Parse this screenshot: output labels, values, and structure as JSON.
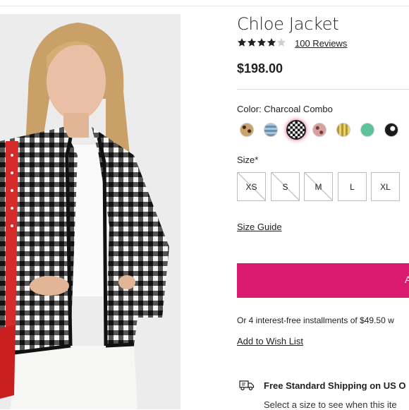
{
  "product": {
    "title": "Chloe Jacket",
    "rating": 4,
    "rating_max": 5,
    "reviews_label": "100 Reviews",
    "price": "$198.00"
  },
  "color": {
    "label": "Color: Charcoal Combo",
    "swatches": [
      {
        "name": "leopard",
        "color": "#c9a36b"
      },
      {
        "name": "blue-plaid",
        "color": "#8fb1cf"
      },
      {
        "name": "charcoal-gingham",
        "color": "#3a3a3a",
        "selected": true
      },
      {
        "name": "pink-leopard",
        "color": "#c88e8e"
      },
      {
        "name": "yellow-stripe",
        "color": "#c9b24a"
      },
      {
        "name": "green",
        "color": "#5cc49a"
      },
      {
        "name": "black-floral",
        "color": "#1a1a1a"
      }
    ]
  },
  "size": {
    "label": "Size*",
    "options": [
      {
        "label": "XS",
        "available": false
      },
      {
        "label": "S",
        "available": false
      },
      {
        "label": "M",
        "available": false
      },
      {
        "label": "L",
        "available": true
      },
      {
        "label": "XL",
        "available": true
      }
    ],
    "guide_label": "Size Guide"
  },
  "actions": {
    "add_to_bag_label": "A",
    "installments_text": "Or 4 interest-free installments of $49.50 w",
    "wishlist_label": "Add to Wish List"
  },
  "shipping": {
    "icon": "truck-icon",
    "title": "Free Standard Shipping on US O",
    "subtitle": "Select a size to see when this ite"
  },
  "colors": {
    "accent": "#d91a6e",
    "text": "#222222",
    "divider": "#dddddd"
  }
}
